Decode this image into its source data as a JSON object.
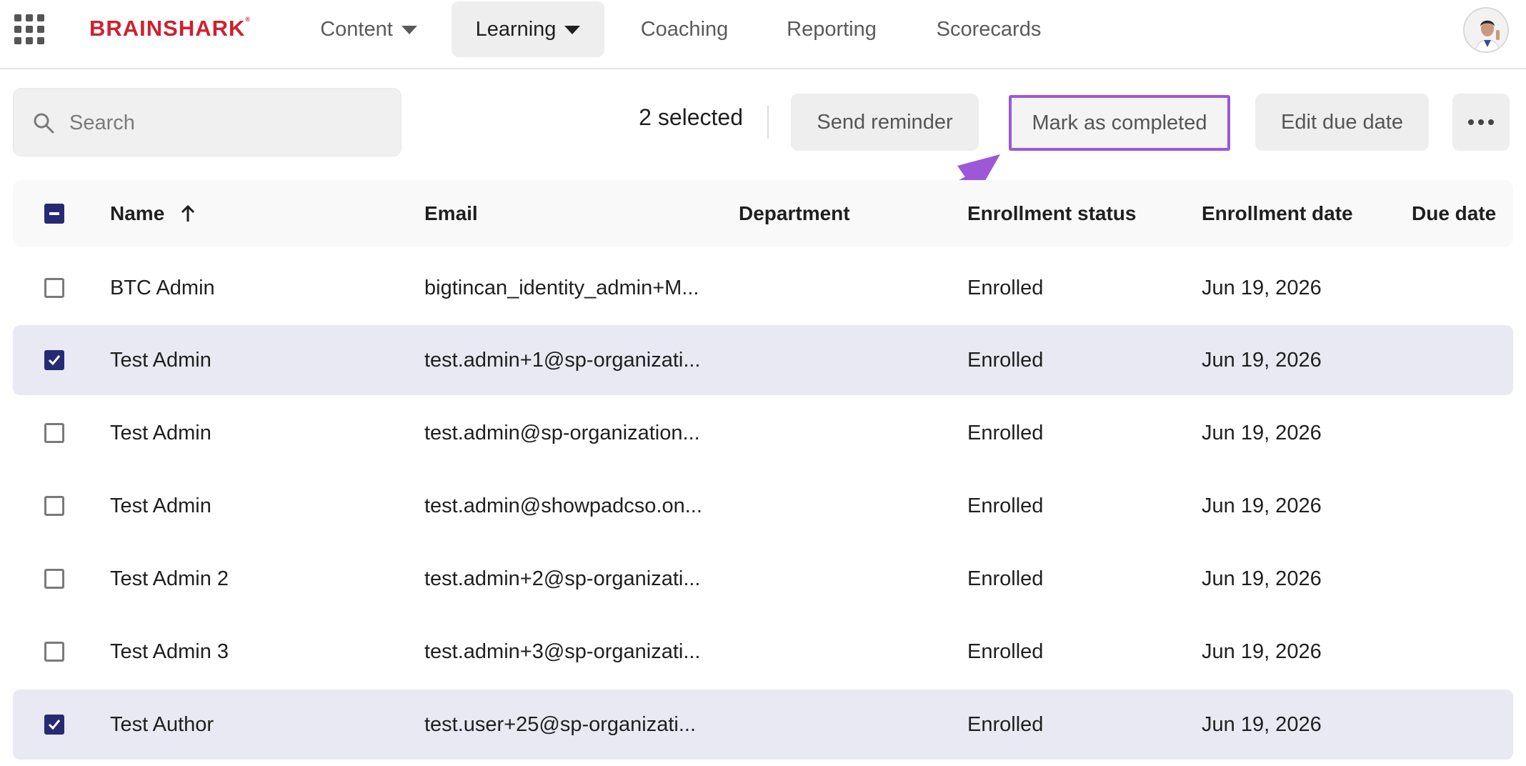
{
  "nav": {
    "logo": "BRAINSHARK",
    "logo_mark": "®",
    "items": [
      {
        "label": "Content",
        "has_caret": true
      },
      {
        "label": "Learning",
        "has_caret": true,
        "active": true
      },
      {
        "label": "Coaching"
      },
      {
        "label": "Reporting"
      },
      {
        "label": "Scorecards"
      }
    ]
  },
  "toolbar": {
    "search_placeholder": "Search",
    "selected_count": "2 selected",
    "send_reminder": "Send reminder",
    "mark_completed": "Mark as completed",
    "edit_due_date": "Edit due date",
    "highlight_color": "#9c58d6"
  },
  "table": {
    "columns": {
      "name": "Name",
      "email": "Email",
      "department": "Department",
      "status": "Enrollment status",
      "enroll_date": "Enrollment date",
      "due_date": "Due date"
    },
    "rows": [
      {
        "name": "BTC Admin",
        "email": "bigtincan_identity_admin+M...",
        "department": "",
        "status": "Enrolled",
        "enroll_date": "Jun 19, 2026",
        "due_date": "",
        "selected": false
      },
      {
        "name": "Test Admin",
        "email": "test.admin+1@sp-organizati...",
        "department": "",
        "status": "Enrolled",
        "enroll_date": "Jun 19, 2026",
        "due_date": "",
        "selected": true
      },
      {
        "name": "Test Admin",
        "email": "test.admin@sp-organization...",
        "department": "",
        "status": "Enrolled",
        "enroll_date": "Jun 19, 2026",
        "due_date": "",
        "selected": false
      },
      {
        "name": "Test Admin",
        "email": "test.admin@showpadcso.on...",
        "department": "",
        "status": "Enrolled",
        "enroll_date": "Jun 19, 2026",
        "due_date": "",
        "selected": false
      },
      {
        "name": "Test Admin 2",
        "email": "test.admin+2@sp-organizati...",
        "department": "",
        "status": "Enrolled",
        "enroll_date": "Jun 19, 2026",
        "due_date": "",
        "selected": false
      },
      {
        "name": "Test Admin 3",
        "email": "test.admin+3@sp-organizati...",
        "department": "",
        "status": "Enrolled",
        "enroll_date": "Jun 19, 2026",
        "due_date": "",
        "selected": false
      },
      {
        "name": "Test Author",
        "email": "test.user+25@sp-organizati...",
        "department": "",
        "status": "Enrolled",
        "enroll_date": "Jun 19, 2026",
        "due_date": "",
        "selected": true
      }
    ]
  },
  "colors": {
    "brand": "#d0202e",
    "checkbox": "#262a73",
    "selected_row": "#e8e9f3"
  },
  "icons": [
    "apps-grid-icon",
    "search-icon",
    "caret-down-icon",
    "sort-ascending-icon",
    "more-options-icon",
    "annotation-arrow-icon"
  ]
}
